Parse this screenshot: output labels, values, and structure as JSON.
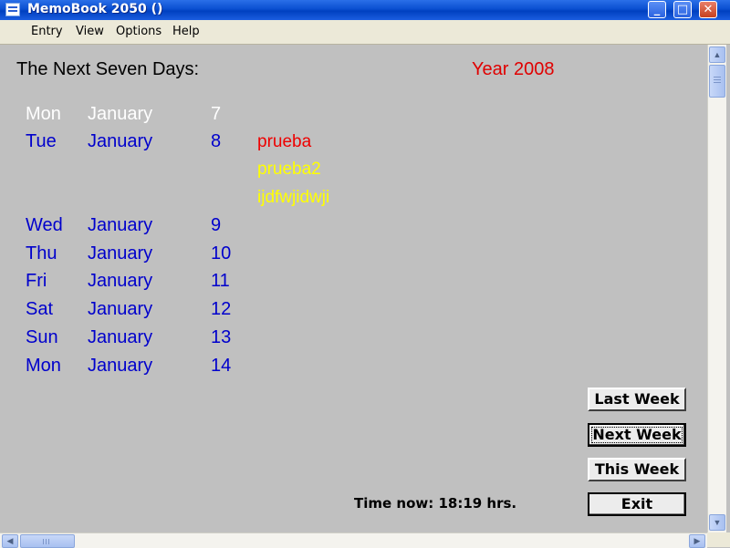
{
  "window": {
    "title": "MemoBook 2050  ()",
    "minimize": "_",
    "maximize": "□",
    "close": "✕"
  },
  "menu": [
    "Entry",
    "View",
    "Options",
    "Help"
  ],
  "header": {
    "heading": "The Next Seven Days:",
    "year": "Year 2008"
  },
  "days": [
    {
      "day": "Mon",
      "month": "January",
      "date": "7",
      "color": "#ffffff"
    },
    {
      "day": "Tue",
      "month": "January",
      "date": "8",
      "color": "#0000cc"
    },
    {
      "day": "Wed",
      "month": "January",
      "date": "9",
      "color": "#0000cc"
    },
    {
      "day": "Thu",
      "month": "January",
      "date": "10",
      "color": "#0000cc"
    },
    {
      "day": "Fri",
      "month": "January",
      "date": "11",
      "color": "#0000cc"
    },
    {
      "day": "Sat",
      "month": "January",
      "date": "12",
      "color": "#0000cc"
    },
    {
      "day": "Sun",
      "month": "January",
      "date": "13",
      "color": "#0000cc"
    },
    {
      "day": "Mon",
      "month": "January",
      "date": "14",
      "color": "#0000cc"
    }
  ],
  "memos": [
    {
      "text": "prueba",
      "color": "#ee0000"
    },
    {
      "text": "prueba2",
      "color": "#ffff00"
    },
    {
      "text": "ijdfwjidwji",
      "color": "#ffff00"
    }
  ],
  "buttons": {
    "last_week": "Last Week",
    "next_week": "Next Week",
    "this_week": "This Week",
    "exit": "Exit"
  },
  "status": {
    "time_now": "Time now: 18:19 hrs."
  },
  "icons": {
    "app": "memobook-app-icon",
    "scroll_up": "▲",
    "scroll_down": "▼",
    "scroll_left": "◀",
    "scroll_right": "▶"
  }
}
